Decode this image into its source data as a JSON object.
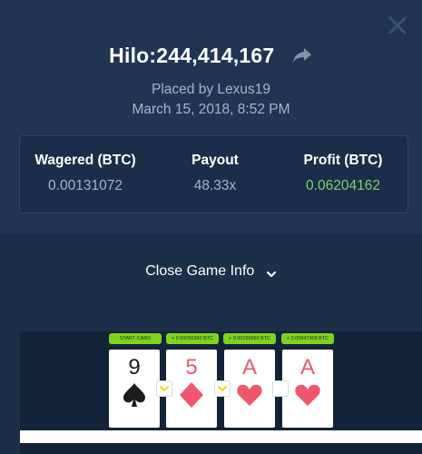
{
  "header": {
    "title": "Hilo:244,414,167",
    "placed_by": "Placed by Lexus19",
    "date": "March 15, 2018, 8:52 PM"
  },
  "stats": {
    "wagered_label": "Wagered (BTC)",
    "wagered_value": "0.00131072",
    "payout_label": "Payout",
    "payout_value": "48.33x",
    "profit_label": "Profit (BTC)",
    "profit_value": "0.06204162"
  },
  "toggle": {
    "label": "Close Game Info"
  },
  "cards": [
    {
      "badge": "START CARD",
      "rank": "9",
      "suit": "spade",
      "color": "black"
    },
    {
      "badge": "+ 0.00056360 BTC",
      "rank": "5",
      "suit": "diamond",
      "color": "red"
    },
    {
      "badge": "+ 0.00299892 BTC",
      "rank": "A",
      "suit": "heart",
      "color": "red"
    },
    {
      "badge": "+ 0.05847908 BTC",
      "rank": "A",
      "suit": "heart",
      "color": "red"
    }
  ],
  "guesses": [
    "lower",
    "lower",
    "none"
  ],
  "colors": {
    "accent_green": "#7ed321",
    "profit_green": "#7ed36a",
    "card_red": "#f0576d",
    "guess_yellow": "#f5d90a"
  }
}
